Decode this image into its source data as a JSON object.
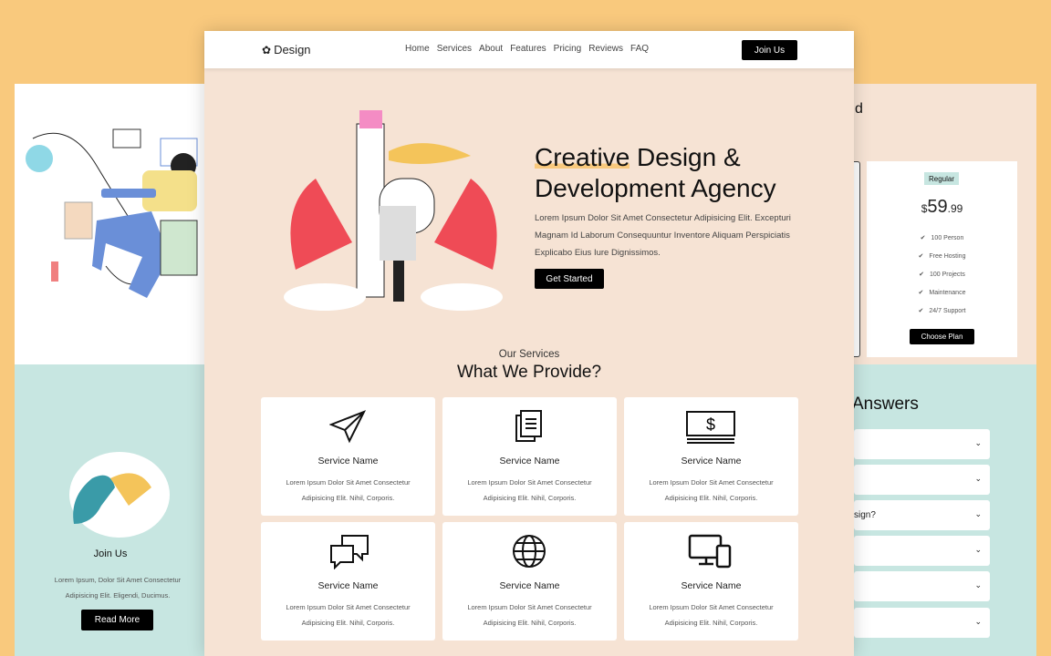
{
  "colors": {
    "background": "#f9c97d",
    "peach": "#f6e3d4",
    "teal": "#c7e6e1",
    "button": "#000000",
    "highlight": "#f9c97d"
  },
  "nav": {
    "logo": "Design",
    "logo_icon": "flower-icon",
    "items": [
      "Home",
      "Services",
      "About",
      "Features",
      "Pricing",
      "Reviews",
      "FAQ"
    ],
    "cta": "Join Us"
  },
  "hero": {
    "title_highlight": "Creative",
    "title_rest": " Design &",
    "title_line2": "Development Agency",
    "text": "Lorem Ipsum Dolor Sit Amet Consectetur Adipisicing Elit. Excepturi Magnam Id Laborum Consequuntur Inventore Aliquam Perspiciatis Explicabo Eius Iure Dignissimos.",
    "button": "Get Started"
  },
  "services": {
    "subtitle": "Our Services",
    "title": "What We Provide?",
    "cards": [
      {
        "icon": "paper-plane-icon",
        "name": "Service Name",
        "line1": "Lorem Ipsum Dolor Sit Amet Consectetur",
        "line2": "Adipisicing Elit. Nihil, Corporis."
      },
      {
        "icon": "documents-icon",
        "name": "Service Name",
        "line1": "Lorem Ipsum Dolor Sit Amet Consectetur",
        "line2": "Adipisicing Elit. Nihil, Corporis."
      },
      {
        "icon": "money-icon",
        "name": "Service Name",
        "line1": "Lorem Ipsum Dolor Sit Amet Consectetur",
        "line2": "Adipisicing Elit. Nihil, Corporis."
      },
      {
        "icon": "chat-icon",
        "name": "Service Name",
        "line1": "Lorem Ipsum Dolor Sit Amet Consectetur",
        "line2": "Adipisicing Elit. Nihil, Corporis."
      },
      {
        "icon": "globe-icon",
        "name": "Service Name",
        "line1": "Lorem Ipsum Dolor Sit Amet Consectetur",
        "line2": "Adipisicing Elit. Nihil, Corporis."
      },
      {
        "icon": "devices-icon",
        "name": "Service Name",
        "line1": "Lorem Ipsum Dolor Sit Amet Consectetur",
        "line2": "Adipisicing Elit. Nihil, Corporis."
      }
    ]
  },
  "left": {
    "title": "Join Us",
    "line1": "Lorem Ipsum, Dolor Sit Amet Consectetur",
    "line2": "Adipisicing Elit. Eligendi, Ducimus.",
    "button": "Read More"
  },
  "pricing": {
    "heading_fragment": "d",
    "badge": "Regular",
    "currency": "$",
    "price_main": "59",
    "price_cents": ".99",
    "features": [
      "100 Person",
      "Free Hosting",
      "100 Projects",
      "Maintenance",
      "24/7 Support"
    ],
    "button": "Choose Plan"
  },
  "faq": {
    "heading_fragment": "Answers",
    "items": [
      "",
      "",
      "sign?",
      "",
      "",
      ""
    ]
  }
}
